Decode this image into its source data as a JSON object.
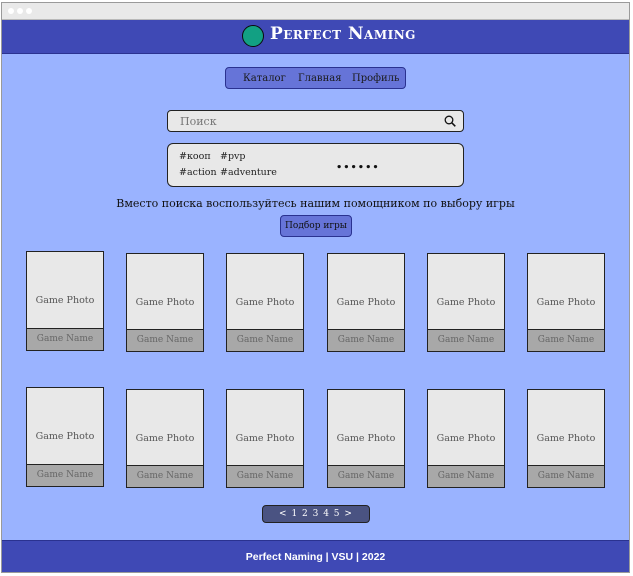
{
  "brand": {
    "name": "Perfect Naming",
    "logo_color": "#12a083"
  },
  "nav": {
    "items": [
      "Каталог",
      "Главная",
      "Профиль"
    ]
  },
  "search": {
    "placeholder": "Поиск",
    "icon": "search-icon"
  },
  "tags": [
    "#кооп",
    "#pvp",
    "#action",
    "#adventure"
  ],
  "tag_overflow": "......",
  "hint": "Вместо поиска воспользуйтесь нашим помощником по выбору игры",
  "pick_button": "Подбор игры",
  "cards": {
    "photo_label": "Game Photo",
    "name_label": "Game Name",
    "rows": 2,
    "per_row": 6
  },
  "pagination": "< 1 2 3 4 5 >",
  "footer": "Perfect Naming | VSU | 2022",
  "colors": {
    "background": "#9ab3ff",
    "header": "#3f49b5",
    "nav": "#6674d8",
    "card": "#e8e8e8",
    "card_name": "#a8a8a8",
    "pager": "#4a5382"
  }
}
